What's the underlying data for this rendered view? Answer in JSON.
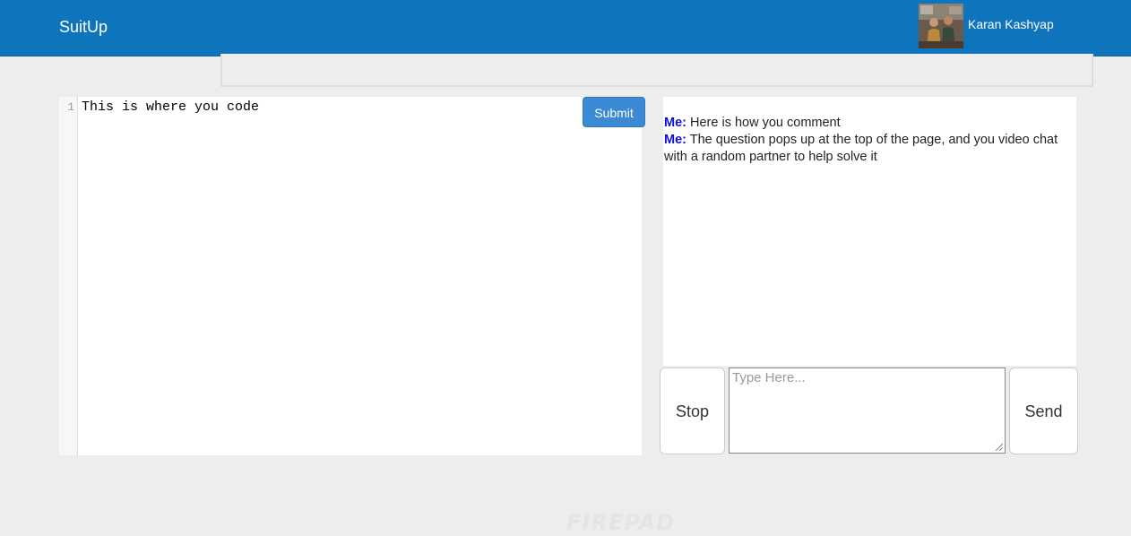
{
  "navbar": {
    "brand": "SuitUp",
    "user_name": "Karan Kashyap",
    "background_color": "#0e74bb"
  },
  "editor": {
    "line_numbers": [
      "1"
    ],
    "code_lines": [
      "This is where you code"
    ],
    "submit_label": "Submit",
    "logo_text": "FIREPAD"
  },
  "chat": {
    "messages": [
      {
        "sender": "Me:",
        "text": "Here is how you comment"
      },
      {
        "sender": "Me:",
        "text": "The question pops up at the top of the page, and you video chat with a random partner to help solve it"
      }
    ],
    "input_placeholder": "Type Here...",
    "input_value": "",
    "stop_label": "Stop",
    "send_label": "Send"
  }
}
